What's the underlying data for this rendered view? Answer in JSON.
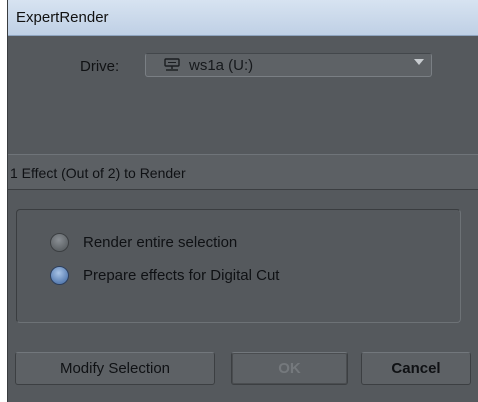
{
  "window": {
    "title": "ExpertRender"
  },
  "drive": {
    "label": "Drive:",
    "icon": "network-drive-icon",
    "value": "ws1a (U:)"
  },
  "status": {
    "text": "1 Effect (Out of 2) to Render"
  },
  "options": [
    {
      "label": "Render entire selection",
      "selected": false
    },
    {
      "label": "Prepare effects for Digital Cut",
      "selected": true
    }
  ],
  "buttons": {
    "modify": "Modify Selection",
    "ok": "OK",
    "cancel": "Cancel"
  },
  "colors": {
    "panel": "#55595d",
    "titlebar": "#cbd9eb",
    "radio_selected": "#6a8fc2"
  }
}
